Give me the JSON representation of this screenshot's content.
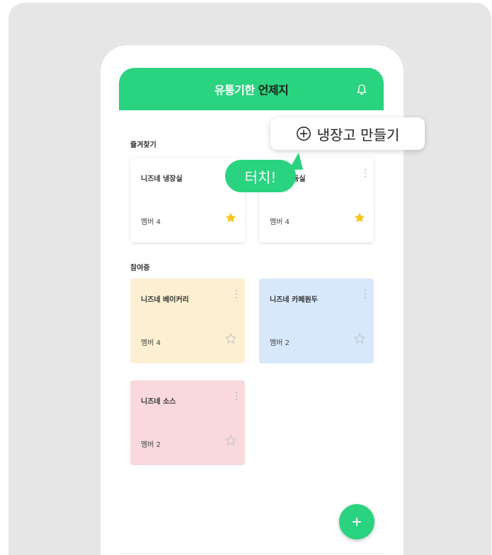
{
  "header": {
    "title_part1": "유통기한",
    "title_part2": "언제지",
    "bell_icon": "bell-icon"
  },
  "sections": {
    "favorites_label": "즐겨찾기",
    "participating_label": "참여중"
  },
  "favorites": [
    {
      "name": "니즈네 냉장실",
      "members": "멤버 4",
      "starred": true,
      "color": "#ffffff"
    },
    {
      "name": "냉동실",
      "members": "멤버 4",
      "starred": true,
      "color": "#ffffff"
    }
  ],
  "participating": [
    {
      "name": "니즈네 베이커리",
      "members": "멤버 4",
      "starred": false,
      "color": "#fdf0d2"
    },
    {
      "name": "니즈네 카페원두",
      "members": "멤버 2",
      "starred": false,
      "color": "#d7e8fb"
    },
    {
      "name": "니즈네 소스",
      "members": "멤버 2",
      "starred": false,
      "color": "#f9d9de"
    }
  ],
  "tooltip": {
    "text": "냉장고 만들기",
    "icon": "plus-circle-icon"
  },
  "touch_hint": "터치!",
  "fab": {
    "icon": "plus-icon"
  },
  "colors": {
    "accent": "#2ad37f",
    "star_filled": "#f5c518",
    "star_empty": "#c4c4c4"
  }
}
